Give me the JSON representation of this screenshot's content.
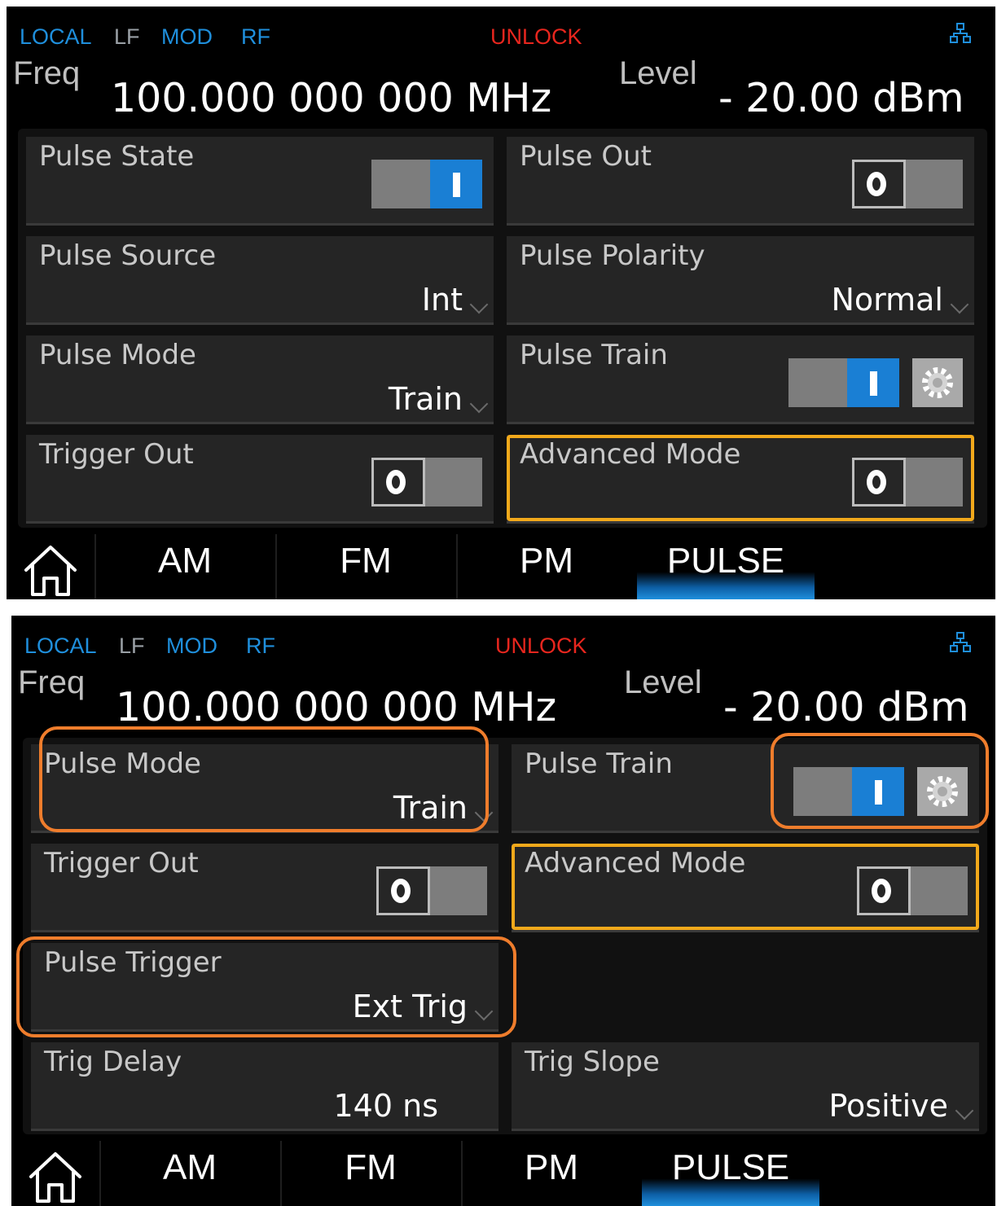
{
  "status_bar": {
    "local": "LOCAL",
    "lf": "LF",
    "mod": "MOD",
    "rf": "RF",
    "unlock": "UNLOCK"
  },
  "freq": {
    "label": "Freq",
    "value": "100.000 000 000  MHz"
  },
  "level": {
    "label": "Level",
    "value": "- 20.00  dBm"
  },
  "screen1": {
    "pulse_state": {
      "label": "Pulse State",
      "toggle": "on"
    },
    "pulse_out": {
      "label": "Pulse Out",
      "toggle": "off"
    },
    "pulse_source": {
      "label": "Pulse Source",
      "value": "Int"
    },
    "pulse_polarity": {
      "label": "Pulse Polarity",
      "value": "Normal"
    },
    "pulse_mode": {
      "label": "Pulse Mode",
      "value": "Train"
    },
    "pulse_train": {
      "label": "Pulse Train",
      "toggle": "on"
    },
    "trigger_out": {
      "label": "Trigger Out",
      "toggle": "off"
    },
    "advanced_mode": {
      "label": "Advanced Mode",
      "toggle": "off"
    }
  },
  "screen2": {
    "pulse_mode": {
      "label": "Pulse Mode",
      "value": "Train"
    },
    "pulse_train": {
      "label": "Pulse Train",
      "toggle": "on"
    },
    "trigger_out": {
      "label": "Trigger Out",
      "toggle": "off"
    },
    "advanced_mode": {
      "label": "Advanced Mode",
      "toggle": "off"
    },
    "pulse_trigger": {
      "label": "Pulse Trigger",
      "value": "Ext Trig"
    },
    "trig_delay": {
      "label": "Trig Delay",
      "value": "140  ns"
    },
    "trig_slope": {
      "label": "Trig Slope",
      "value": "Positive"
    }
  },
  "tabs": [
    "AM",
    "FM",
    "PM",
    "PULSE"
  ],
  "active_tab": "PULSE",
  "icons": {
    "home": "home-icon",
    "network": "network-icon",
    "settings": "gear-icon"
  },
  "colors": {
    "accent_blue": "#1f8fdc",
    "unlock_red": "#e8261e",
    "highlight_yellow": "#f2a91b",
    "highlight_orange": "#ef7d2c"
  }
}
